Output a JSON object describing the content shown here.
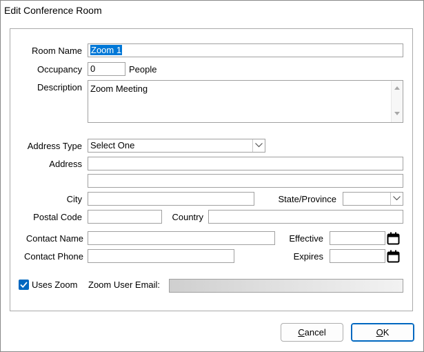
{
  "window": {
    "title": "Edit Conference Room"
  },
  "form": {
    "room_name_label": "Room Name",
    "room_name_value": "Zoom 1",
    "occupancy_label": "Occupancy",
    "occupancy_value": "0",
    "occupancy_unit": "People",
    "description_label": "Description",
    "description_value": "Zoom Meeting",
    "address_type_label": "Address Type",
    "address_type_value": "Select One",
    "address_label": "Address",
    "address_line1": "",
    "address_line2": "",
    "city_label": "City",
    "city_value": "",
    "state_label": "State/Province",
    "state_value": "",
    "postal_label": "Postal Code",
    "postal_value": "",
    "country_label": "Country",
    "country_value": "",
    "contact_name_label": "Contact Name",
    "contact_name_value": "",
    "contact_phone_label": "Contact Phone",
    "contact_phone_value": "",
    "effective_label": "Effective",
    "effective_value": "",
    "expires_label": "Expires",
    "expires_value": "",
    "uses_zoom_label": "Uses Zoom",
    "uses_zoom_checked": true,
    "zoom_email_label": "Zoom User Email:",
    "zoom_email_value": ""
  },
  "buttons": {
    "cancel_mnemonic": "C",
    "cancel_rest": "ancel",
    "ok_mnemonic": "O",
    "ok_rest": "K"
  },
  "colors": {
    "accent": "#0067c0",
    "selection": "#0078d7"
  }
}
